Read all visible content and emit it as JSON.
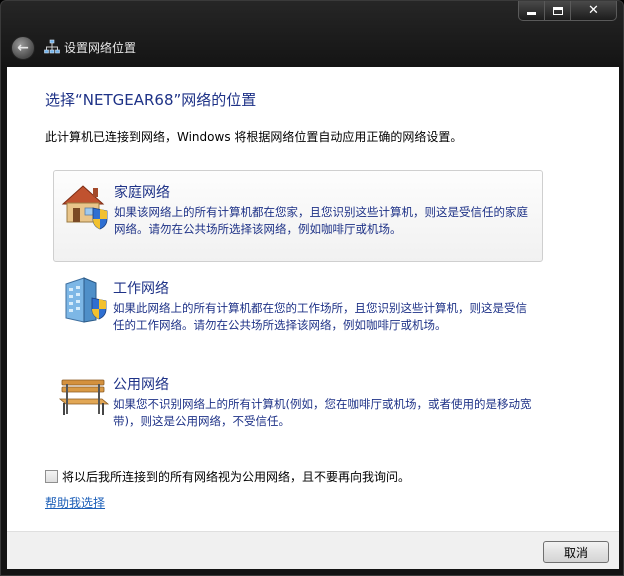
{
  "window": {
    "title": "设置网络位置",
    "caption": {
      "minimize": "",
      "maximize": "",
      "close": "✕"
    }
  },
  "header": {
    "heading": "选择“NETGEAR68”网络的位置",
    "intro": "此计算机已连接到网络，Windows 将根据网络位置自动应用正确的网络设置。"
  },
  "options": [
    {
      "title": "家庭网络",
      "description": "如果该网络上的所有计算机都在您家，且您识别这些计算机，则这是受信任的家庭网络。请勿在公共场所选择该网络，例如咖啡厅或机场。",
      "icon": "home-network-icon"
    },
    {
      "title": "工作网络",
      "description": "如果此网络上的所有计算机都在您的工作场所，且您识别这些计算机，则这是受信任的工作网络。请勿在公共场所选择该网络，例如咖啡厅或机场。",
      "icon": "work-network-icon"
    },
    {
      "title": "公用网络",
      "description": "如果您不识别网络上的所有计算机(例如，您在咖啡厅或机场，或者使用的是移动宽带)，则这是公用网络，不受信任。",
      "icon": "public-network-bench-icon"
    }
  ],
  "checkbox": {
    "label": "将以后我所连接到的所有网络视为公用网络，且不要再向我询问。",
    "checked": false
  },
  "help_link": "帮助我选择",
  "footer": {
    "cancel_label": "取消"
  },
  "colors": {
    "heading": "#1e3287",
    "link": "#1c5fb8",
    "frame": "#1a1a1a"
  }
}
